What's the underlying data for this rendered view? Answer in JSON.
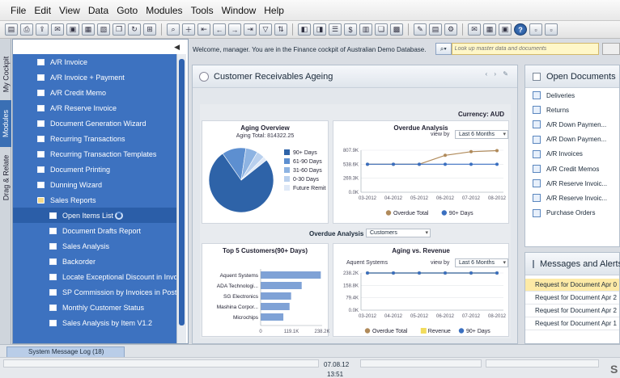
{
  "menu": [
    "File",
    "Edit",
    "View",
    "Data",
    "Goto",
    "Modules",
    "Tools",
    "Window",
    "Help"
  ],
  "vtabs": [
    "My Cockpit",
    "Modules",
    "Drag & Relate"
  ],
  "sidebar": {
    "items": [
      {
        "label": "A/R Invoice",
        "level": 1,
        "icon": "document-icon"
      },
      {
        "label": "A/R Invoice + Payment",
        "level": 1,
        "icon": "document-icon"
      },
      {
        "label": "A/R Credit Memo",
        "level": 1,
        "icon": "document-icon"
      },
      {
        "label": "A/R Reserve Invoice",
        "level": 1,
        "icon": "document-icon"
      },
      {
        "label": "Document Generation Wizard",
        "level": 1,
        "icon": "document-icon"
      },
      {
        "label": "Recurring Transactions",
        "level": 1,
        "icon": "document-icon"
      },
      {
        "label": "Recurring Transaction Templates",
        "level": 1,
        "icon": "document-icon"
      },
      {
        "label": "Document Printing",
        "level": 1,
        "icon": "document-icon"
      },
      {
        "label": "Dunning Wizard",
        "level": 1,
        "icon": "document-icon"
      },
      {
        "label": "Sales Reports",
        "level": 1,
        "icon": "folder-open-icon"
      },
      {
        "label": "Open Items List",
        "level": 2,
        "icon": "document-icon",
        "selected": true
      },
      {
        "label": "Document Drafts Report",
        "level": 2,
        "icon": "document-icon"
      },
      {
        "label": "Sales Analysis",
        "level": 2,
        "icon": "document-icon"
      },
      {
        "label": "Backorder",
        "level": 2,
        "icon": "document-icon"
      },
      {
        "label": "Locate Exceptional Discount in Invoice",
        "level": 2,
        "icon": "document-icon"
      },
      {
        "label": "SP Commission by Invoices in Posting",
        "level": 2,
        "icon": "document-icon"
      },
      {
        "label": "Monthly Customer Status",
        "level": 2,
        "icon": "document-icon"
      },
      {
        "label": "Sales Analysis by Item V1.2",
        "level": 2,
        "icon": "document-icon"
      }
    ]
  },
  "welcome": "Welcome, manager. You are in the Finance cockpit of Australian Demo Database.",
  "search": {
    "placeholder": "Look up master data and documents"
  },
  "ageing": {
    "title": "Customer Receivables Ageing",
    "currency": "Currency: AUD",
    "overdue_by_label": "Overdue Analysis by",
    "overdue_by_value": "Customers"
  },
  "open_documents": {
    "title": "Open Documents",
    "items": [
      "Deliveries",
      "Returns",
      "A/R Down Paymen...",
      "A/R Down Paymen...",
      "A/R Invoices",
      "A/R Credit Memos",
      "A/R Reserve Invoic...",
      "A/R Reserve Invoic...",
      "Purchase Orders"
    ]
  },
  "messages": {
    "title": "Messages and Alerts",
    "items": [
      "Request for Document Apr 0",
      "Request for Document Apr 2",
      "Request for Document Apr 2",
      "Request for Document Apr 1"
    ]
  },
  "bottom": {
    "syslog_tab": "System Message Log (18)",
    "date": "07.08.12",
    "time": "13:51",
    "logo": "S"
  },
  "chart_data": [
    {
      "type": "pie",
      "title": "Aging Overview",
      "subtitle": "Aging Total: 814322.25",
      "categories": [
        "90+ Days",
        "61-90 Days",
        "31-60 Days",
        "0-30 Days",
        "Future Remit"
      ],
      "values": [
        76,
        12,
        6,
        4,
        2
      ],
      "colors": [
        "#2e63a8",
        "#5d8fd0",
        "#8db3e2",
        "#b9d0ee",
        "#dfe9f7"
      ]
    },
    {
      "type": "line",
      "title": "Overdue Analysis",
      "view_by_label": "view by",
      "view_by_value": "Last 6 Months",
      "categories": [
        "03-2012",
        "04-2012",
        "05-2012",
        "06-2012",
        "07-2012",
        "08-2012"
      ],
      "yticks": [
        "807.9K",
        "538.6K",
        "269.3K",
        "0.0K"
      ],
      "ylim": [
        0,
        807.9
      ],
      "series": [
        {
          "name": "Overdue Total",
          "color": "#b08a5a",
          "values": [
            538.6,
            538.6,
            538.6,
            710,
            780,
            800
          ]
        },
        {
          "name": "90+ Days",
          "color": "#3a6fc0",
          "values": [
            538.6,
            538.6,
            538.6,
            538.6,
            538.6,
            538.6
          ]
        }
      ]
    },
    {
      "type": "bar",
      "title": "Top 5 Customers(90+ Days)",
      "categories": [
        "Aquent Systems",
        "ADA Technologi...",
        "SG Electronics",
        "Mashina Corpor...",
        "Microchips"
      ],
      "values": [
        233,
        159,
        118,
        112,
        88
      ],
      "xticks": [
        "0",
        "119.1K",
        "238.2K"
      ],
      "xlim": [
        0,
        238.2
      ],
      "color": "#7fa2d6"
    },
    {
      "type": "line",
      "title": "Aging vs. Revenue",
      "customer": "Aquent Systems",
      "view_by_label": "view by",
      "view_by_value": "Last 6 Months",
      "categories": [
        "03-2012",
        "04-2012",
        "05-2012",
        "06-2012",
        "07-2012",
        "08-2012"
      ],
      "yticks": [
        "238.2K",
        "158.8K",
        "79.4K",
        "0.0K"
      ],
      "ylim": [
        0,
        238.2
      ],
      "series": [
        {
          "name": "Overdue Total",
          "color": "#b08a5a",
          "values": [
            238.2,
            238.2,
            238.2,
            238.2,
            238.2,
            238.2
          ]
        },
        {
          "name": "Revenue",
          "color": "#f2dc5d",
          "values": [
            238.2,
            238.2,
            238.2,
            238.2,
            238.2,
            238.2
          ]
        },
        {
          "name": "90+ Days",
          "color": "#3a6fc0",
          "values": [
            238.2,
            238.2,
            238.2,
            238.2,
            238.2,
            238.2
          ]
        }
      ]
    }
  ]
}
